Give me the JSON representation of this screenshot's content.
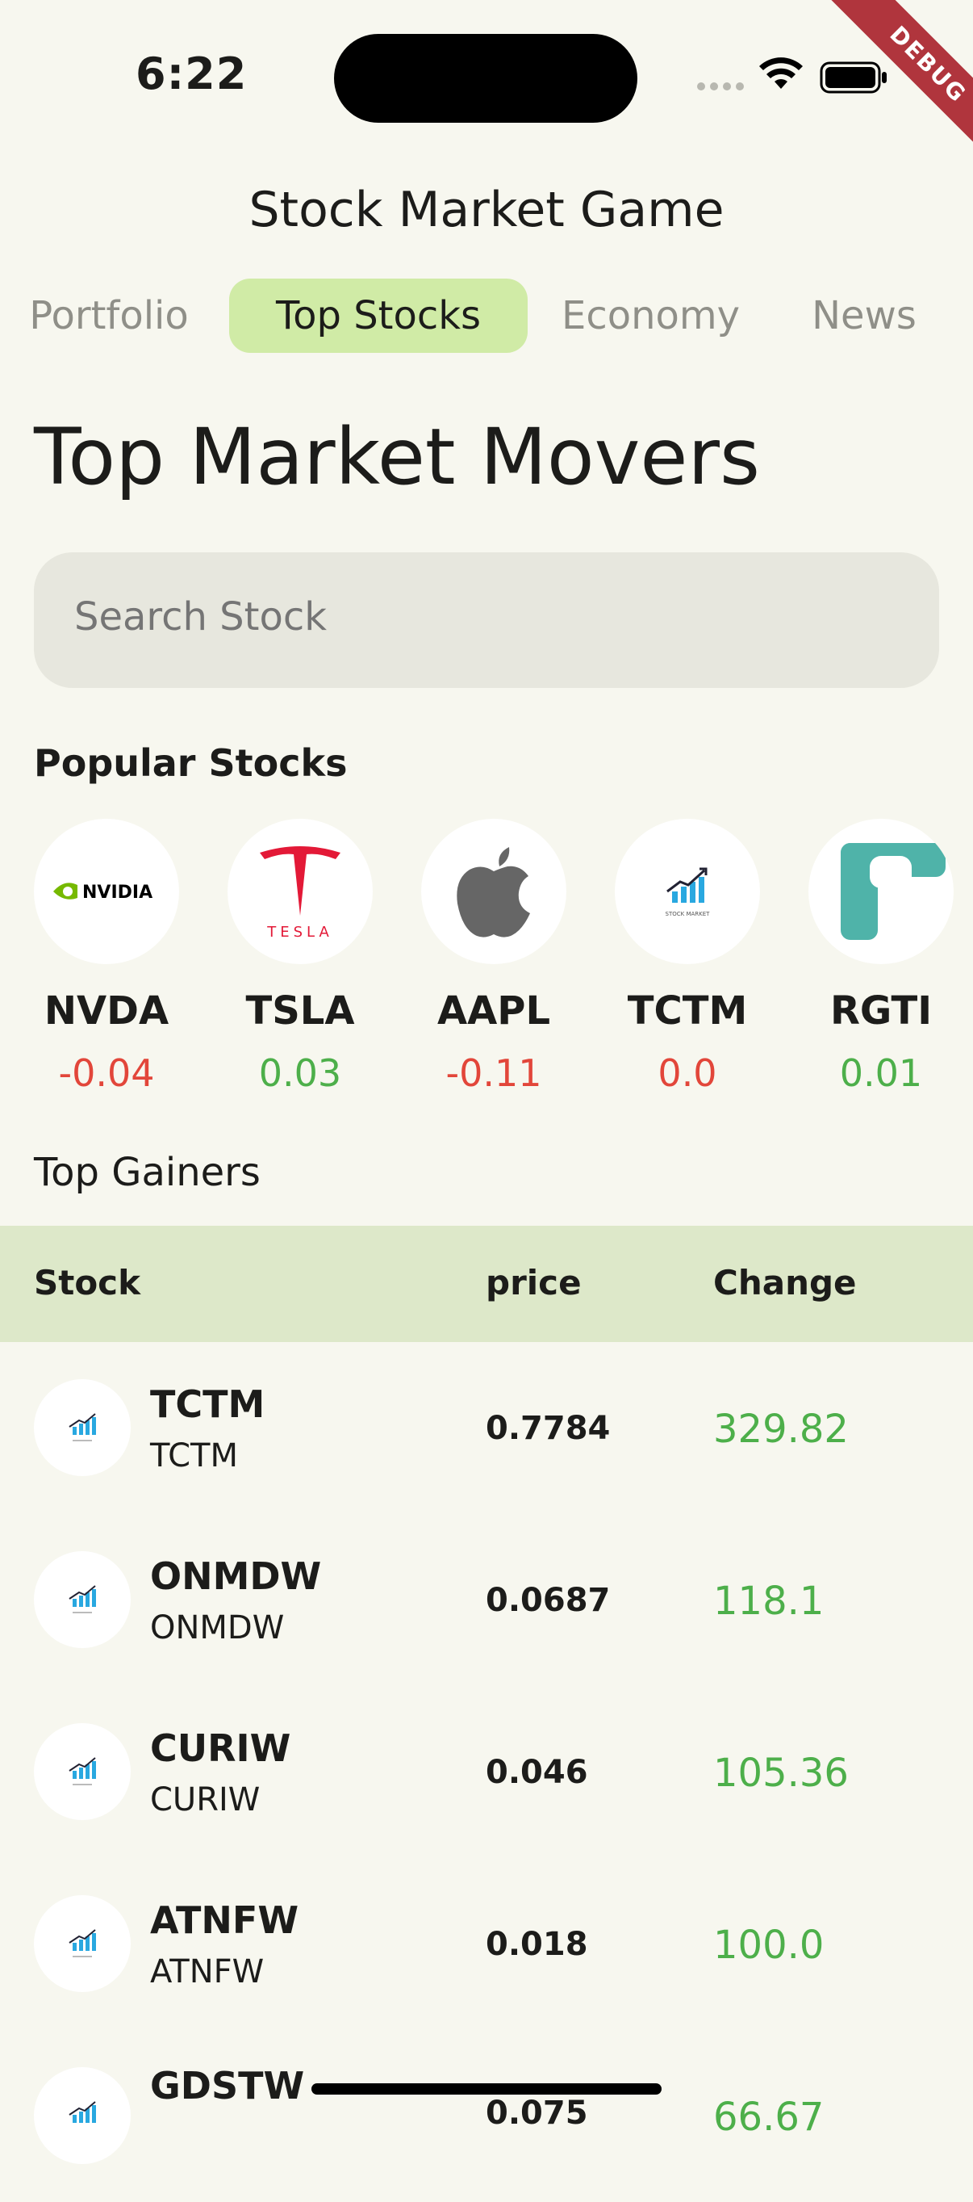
{
  "status_bar": {
    "time": "6:22",
    "debug_label": "DEBUG"
  },
  "app": {
    "title": "Stock Market Game"
  },
  "tabs": [
    {
      "label": "Portfolio",
      "active": false
    },
    {
      "label": "Top Stocks",
      "active": true
    },
    {
      "label": "Economy",
      "active": false
    },
    {
      "label": "News",
      "active": false
    }
  ],
  "page": {
    "heading": "Top Market Movers"
  },
  "search": {
    "placeholder": "Search Stock"
  },
  "popular": {
    "heading": "Popular Stocks",
    "items": [
      {
        "ticker": "NVDA",
        "change": "-0.04",
        "logo": "nvidia-logo",
        "logo_text": "NVIDIA"
      },
      {
        "ticker": "TSLA",
        "change": "0.03",
        "logo": "tesla-logo",
        "logo_text": "TESLA"
      },
      {
        "ticker": "AAPL",
        "change": "-0.11",
        "logo": "apple-logo"
      },
      {
        "ticker": "TCTM",
        "change": "0.0",
        "logo": "stock-market-logo",
        "logo_text": "STOCK MARKET"
      },
      {
        "ticker": "RGTI",
        "change": "0.01",
        "logo": "rigetti-logo"
      }
    ]
  },
  "gainers": {
    "heading": "Top Gainers",
    "columns": [
      "Stock",
      "price",
      "Change"
    ],
    "rows": [
      {
        "symbol": "TCTM",
        "name": "TCTM",
        "price": "0.7784",
        "change": "329.82"
      },
      {
        "symbol": "ONMDW",
        "name": "ONMDW",
        "price": "0.0687",
        "change": "118.1"
      },
      {
        "symbol": "CURIW",
        "name": "CURIW",
        "price": "0.046",
        "change": "105.36"
      },
      {
        "symbol": "ATNFW",
        "name": "ATNFW",
        "price": "0.018",
        "change": "100.0"
      },
      {
        "symbol": "GDSTW",
        "name": "",
        "price": "0.075",
        "change": "66.67"
      }
    ]
  },
  "colors": {
    "accent_tab": "#d0eba6",
    "table_header": "#dde8c9",
    "positive": "#4daf4a",
    "negative": "#e2463a",
    "background": "#f7f7ef",
    "debug_banner": "#b0353d"
  }
}
